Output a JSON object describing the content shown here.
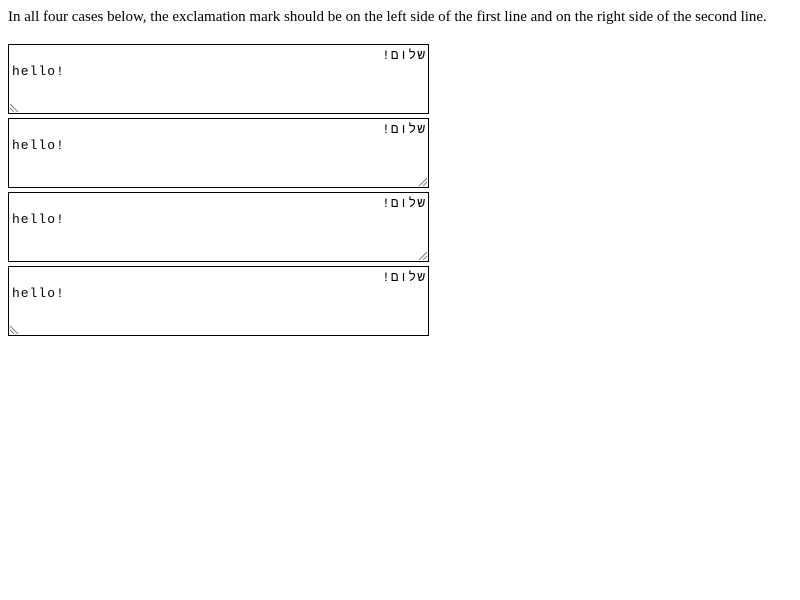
{
  "instructions": "In all four cases below, the exclamation mark should be on the left side of the first line and on the right side of the second line.",
  "textareas": [
    {
      "line1": "שלום!",
      "line2": "hello!",
      "grip": "resize-grip-left-icon"
    },
    {
      "line1": "שלום!",
      "line2": "hello!",
      "grip": "resize-grip-right-icon"
    },
    {
      "line1": "שלום!",
      "line2": "hello!",
      "grip": "resize-grip-right-icon"
    },
    {
      "line1": "שלום!",
      "line2": "hello!",
      "grip": "resize-grip-left-icon"
    }
  ],
  "colors": {
    "border": "#000000",
    "grip": "#808080",
    "background": "#ffffff"
  }
}
